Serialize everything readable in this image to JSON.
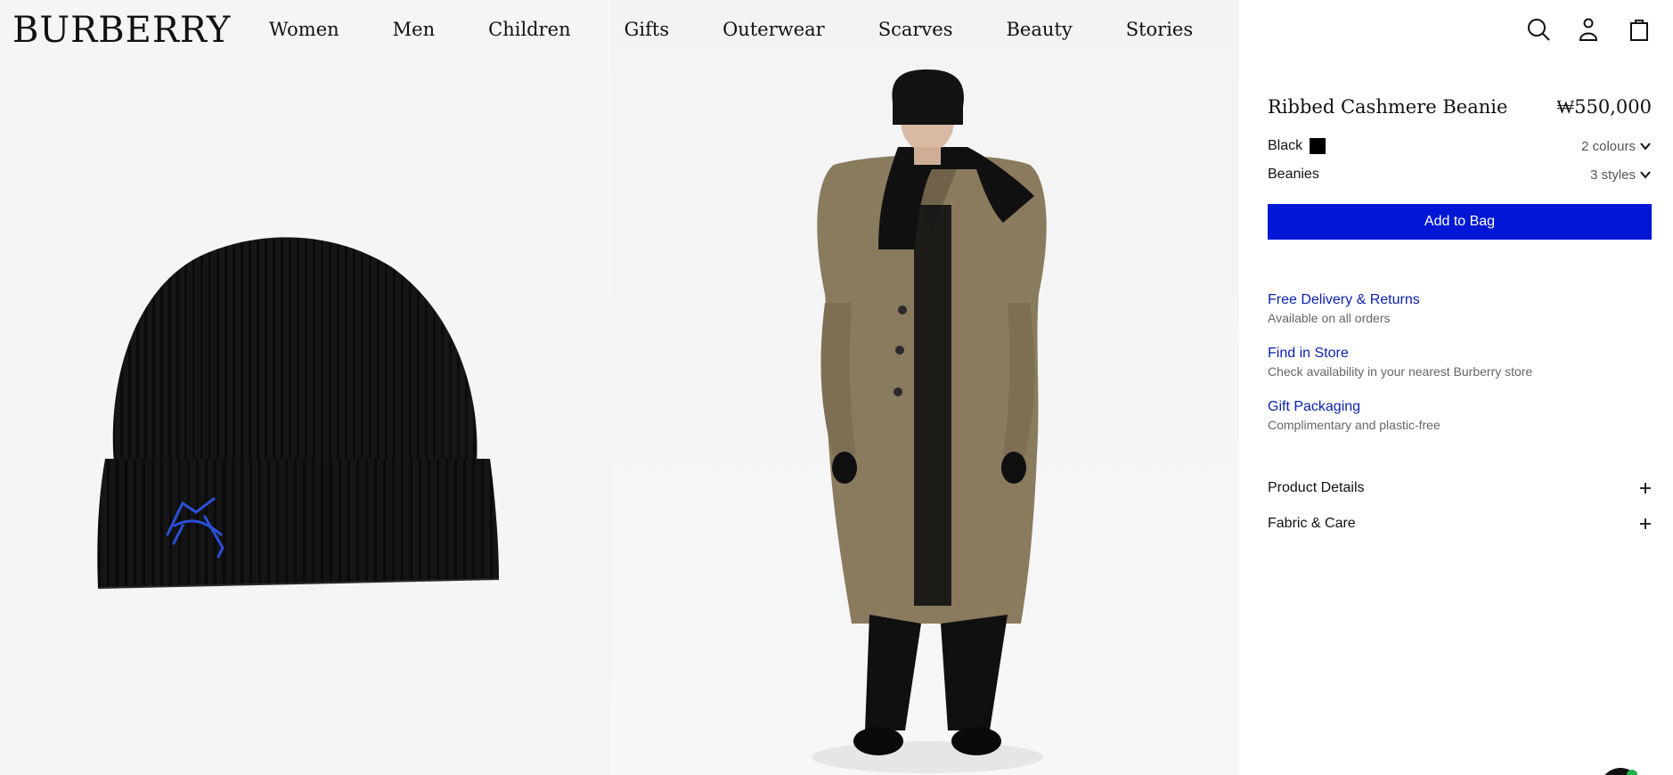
{
  "brand": {
    "logo": "BURBERRY"
  },
  "nav": {
    "items": [
      "Women",
      "Men",
      "Children",
      "Gifts",
      "Outerwear",
      "Scarves",
      "Beauty",
      "Stories"
    ]
  },
  "utility": {
    "icons": [
      "search-icon",
      "account-icon",
      "bag-icon"
    ]
  },
  "product": {
    "title": "Ribbed Cashmere Beanie",
    "price": "₩550,000",
    "colour_label": "Black",
    "colour_swatch": "#000000",
    "colours_selector": "2 colours",
    "style_label": "Beanies",
    "styles_selector": "3 styles",
    "add_button": "Add to Bag",
    "add_button_color": "#0018d5"
  },
  "services": [
    {
      "title": "Free Delivery & Returns",
      "sub": "Available on all orders"
    },
    {
      "title": "Find in Store",
      "sub": "Check availability in your nearest Burberry store"
    },
    {
      "title": "Gift Packaging",
      "sub": "Complimentary and plastic-free"
    }
  ],
  "accordion": [
    {
      "label": "Product Details"
    },
    {
      "label": "Fabric & Care"
    }
  ]
}
